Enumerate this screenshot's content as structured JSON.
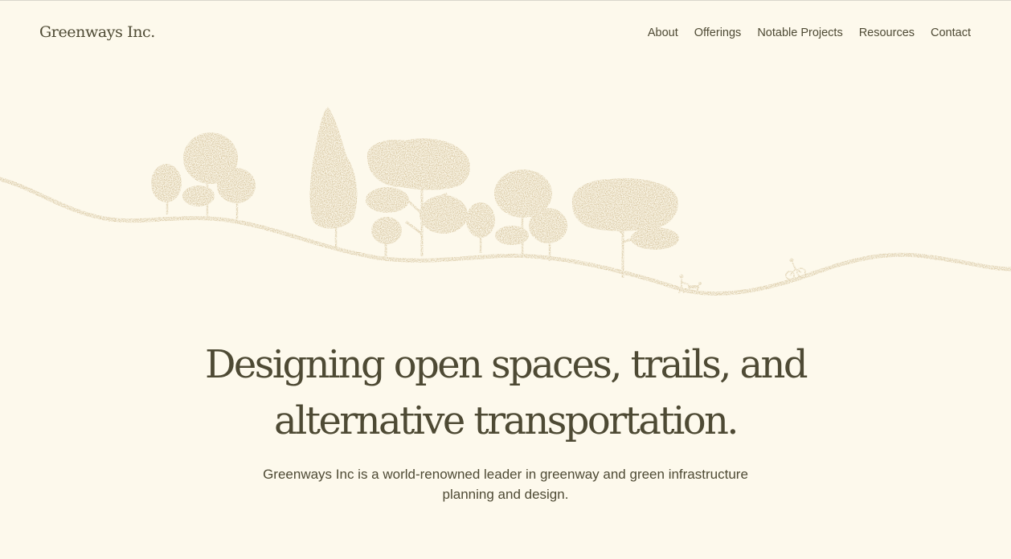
{
  "header": {
    "brand": "Greenways Inc."
  },
  "nav": {
    "items": [
      {
        "label": "About"
      },
      {
        "label": "Offerings"
      },
      {
        "label": "Notable Projects"
      },
      {
        "label": "Resources"
      },
      {
        "label": "Contact"
      }
    ]
  },
  "hero": {
    "headline_line1": "Designing open spaces, trails, and",
    "headline_line2": "alternative transportation.",
    "subtitle": "Greenways Inc is a world-renowned leader in greenway and green infrastructure planning and design."
  },
  "colors": {
    "background": "#fdf9ec",
    "text": "#4e4a34",
    "illustration": "#c0a773"
  }
}
